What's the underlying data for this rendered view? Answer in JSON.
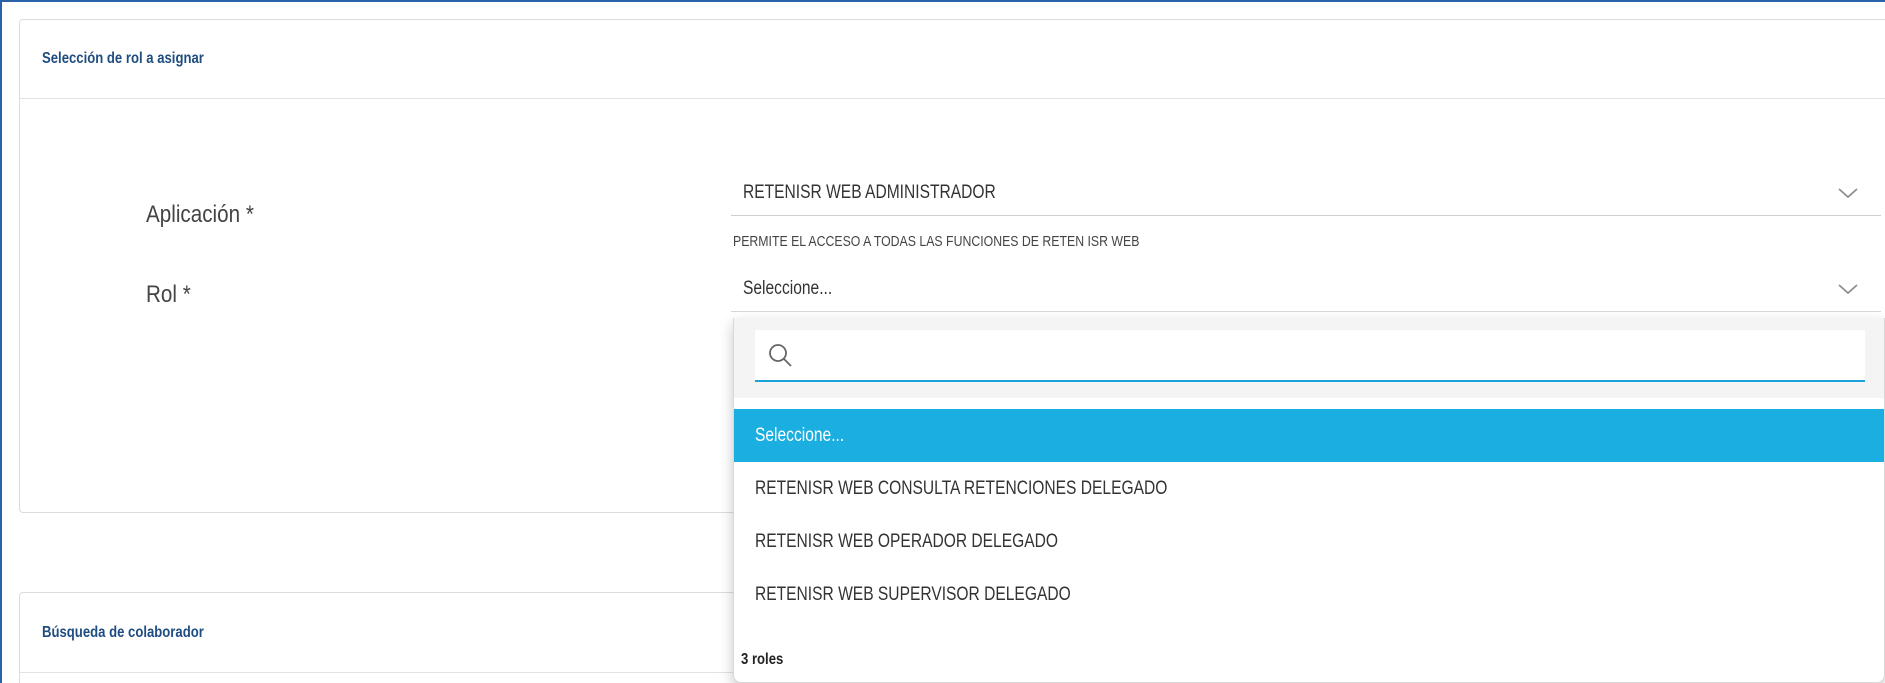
{
  "section_role": {
    "title": "Selección de rol a asignar",
    "application": {
      "label": "Aplicación *",
      "selected": "RETENISR WEB ADMINISTRADOR",
      "description": "PERMITE EL ACCESO A TODAS LAS FUNCIONES DE RETEN ISR WEB"
    },
    "role": {
      "label": "Rol *",
      "selected": "Seleccione..."
    }
  },
  "dropdown": {
    "search_value": "",
    "options": [
      "Seleccione...",
      "RETENISR WEB CONSULTA RETENCIONES DELEGADO",
      "RETENISR WEB OPERADOR DELEGADO",
      "RETENISR WEB SUPERVISOR DELEGADO"
    ],
    "count_label": "3 roles"
  },
  "section_search": {
    "title": "Búsqueda de colaborador"
  },
  "icons": {
    "chevron": "chevron-down-icon",
    "search": "search-icon"
  },
  "colors": {
    "accent": "#1aaee1",
    "title": "#1f4d82",
    "frame": "#2a62a8"
  }
}
